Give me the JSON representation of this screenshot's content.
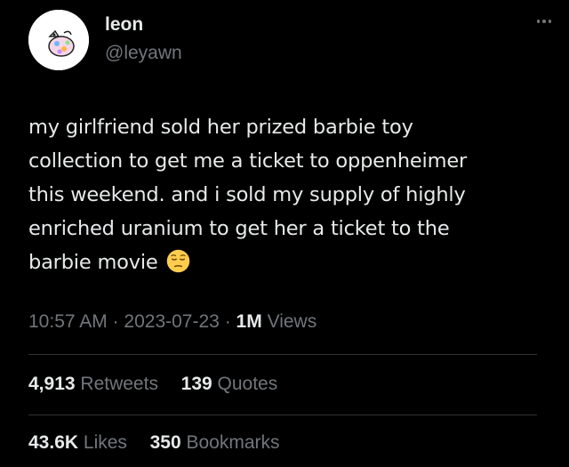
{
  "author": {
    "name": "leon",
    "handle": "@leyawn"
  },
  "tweet": {
    "lines": [
      "my girlfriend sold her prized barbie toy",
      "collection to get me a ticket to oppenheimer",
      "this weekend. and i sold my supply of highly",
      "enriched uranium to get her a ticket to the",
      "barbie movie"
    ],
    "emoji": "pensive-face-icon"
  },
  "meta": {
    "time": "10:57 AM",
    "sep1": "·",
    "date": "2023-07-23",
    "sep2": "·",
    "views_count": "1M",
    "views_label": "Views"
  },
  "stats": {
    "retweets_count": "4,913",
    "retweets_label": "Retweets",
    "quotes_count": "139",
    "quotes_label": "Quotes",
    "likes_count": "43.6K",
    "likes_label": "Likes",
    "bookmarks_count": "350",
    "bookmarks_label": "Bookmarks"
  },
  "colors": {
    "background": "#000000",
    "text": "#e7e9ea",
    "secondary": "#71767b",
    "divider": "#2f3336"
  }
}
